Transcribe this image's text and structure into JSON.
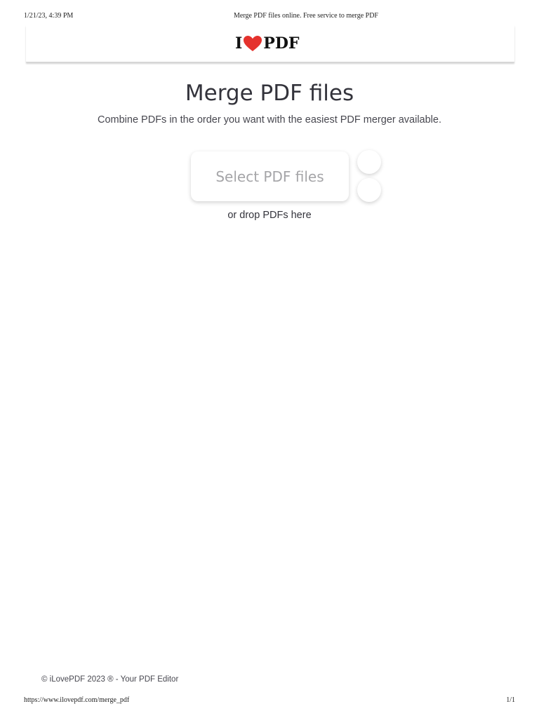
{
  "print_header": {
    "date": "1/21/23, 4:39 PM",
    "title": "Merge PDF files online. Free service to merge PDF"
  },
  "logo": {
    "prefix": "I",
    "suffix": "PDF",
    "heart_color": "#e5322d"
  },
  "main": {
    "title": "Merge PDF files",
    "subtitle": "Combine PDFs in the order you want with the easiest PDF merger available.",
    "select_button_label": "Select PDF files",
    "drop_hint": "or drop PDFs here"
  },
  "footer": {
    "copyright": "© iLovePDF 2023 ® - Your PDF Editor"
  },
  "print_footer": {
    "url": "https://www.ilovepdf.com/merge_pdf",
    "page": "1/1"
  }
}
